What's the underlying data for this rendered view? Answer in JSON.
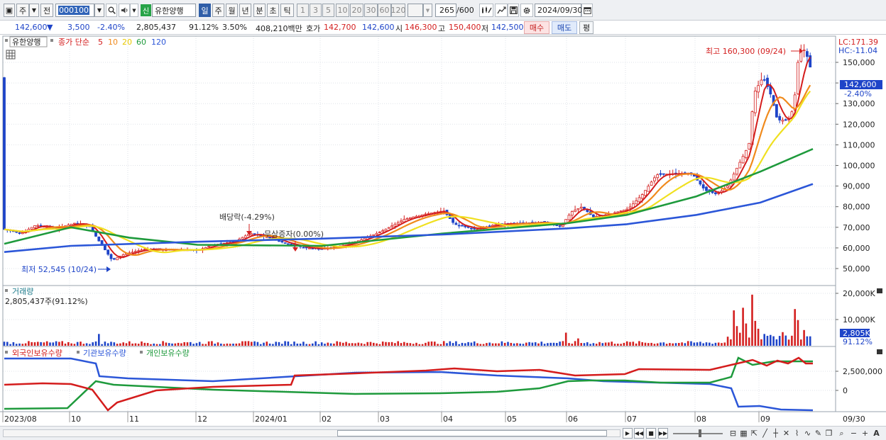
{
  "toolbar": {
    "period_label": "주",
    "prev_label": "전",
    "stock_code": "000100",
    "new_badge": "신",
    "stock_name": "유한양행",
    "timeframes": [
      "일",
      "주",
      "월",
      "년",
      "분",
      "초",
      "틱"
    ],
    "active_timeframe": "일",
    "intervals": [
      "1",
      "3",
      "5",
      "10",
      "20",
      "30",
      "60",
      "120"
    ],
    "bar_count": "265",
    "bar_total": "/600",
    "date": "2024/09/30"
  },
  "info": {
    "price": "142,600",
    "change_arrow": "▼",
    "change": "3,500",
    "change_pct": "-2.40%",
    "volume": "2,805,437",
    "volume_ratio": "91.12%",
    "turnover_pct": "3.50%",
    "amount": "408,210백만",
    "bid_label": "호가",
    "bid": "142,700",
    "ask": "142,600",
    "open_label": "시",
    "open": "146,300",
    "high_label": "고",
    "high": "150,400",
    "low_label": "저",
    "low": "142,500",
    "buy_label": "매수",
    "sell_label": "매도",
    "eval_label": "평"
  },
  "legend": {
    "stock": "유한양행",
    "ma_label": "종가 단순",
    "ma_periods": [
      "5",
      "10",
      "20",
      "60",
      "120"
    ],
    "ma_colors": [
      "#d41c1c",
      "#f08a1c",
      "#f0e020",
      "#1e9a3c",
      "#2b56d8"
    ]
  },
  "price_panel": {
    "lc": "LC:171.39",
    "hc": "HC:-11.04",
    "y_ticks": [
      "150,000",
      "140,000",
      "130,000",
      "120,000",
      "110,000",
      "100,000",
      "90,000",
      "80,000",
      "70,000",
      "60,000",
      "50,000"
    ],
    "current_tag": "142,600",
    "current_pct": "-2.40%",
    "high_annotation": "최고 160,300 (09/24)",
    "low_annotation": "최저 52,545 (10/24)",
    "dividend_annotation": "배당락(-4.29%)",
    "bonus_annotation": "무상증자(0.00%)"
  },
  "volume_panel": {
    "title": "거래량",
    "current": "2,805,437주(91.12%)",
    "y_ticks": [
      "20,000K",
      "10,000K"
    ],
    "tag_value": "2,805K",
    "tag_pct": "91.12%"
  },
  "holdings_panel": {
    "labels": [
      "외국인보유수량",
      "기관보유수량",
      "개인보유수량"
    ],
    "colors": [
      "#d41c1c",
      "#2b56d8",
      "#1e9a3c"
    ],
    "y_ticks": [
      "2,500,000",
      "0"
    ]
  },
  "x_axis": [
    "2023/08",
    "10",
    "11",
    "12",
    "2024/01",
    "02",
    "03",
    "04",
    "05",
    "06",
    "07",
    "08",
    "09",
    "09/30"
  ],
  "colors": {
    "up": "#d42020",
    "down": "#1e44c8",
    "accent": "#2f5ea8"
  },
  "chart_data": {
    "type": "line",
    "title": "",
    "series": [
      {
        "name": "종가",
        "x": [
          "2023/08",
          "2023/10",
          "2023/10/24",
          "2023/11",
          "2023/12",
          "2024/01",
          "2024/02",
          "2024/03",
          "2024/04",
          "2024/05",
          "2024/06",
          "2024/07",
          "2024/08",
          "2024/09",
          "2024/09/24",
          "2024/09/30"
        ],
        "values": [
          69000,
          71000,
          54000,
          59000,
          59500,
          66000,
          60000,
          70000,
          77000,
          72000,
          80000,
          94000,
          88000,
          145000,
          158000,
          142600
        ]
      },
      {
        "name": "120",
        "x": [
          "2023/08",
          "2023/10",
          "2023/12",
          "2024/02",
          "2024/04",
          "2024/06",
          "2024/07",
          "2024/08",
          "2024/09",
          "2024/09/30"
        ],
        "values": [
          58000,
          61000,
          63000,
          64500,
          66500,
          69500,
          71500,
          76000,
          82000,
          91000
        ]
      },
      {
        "name": "60",
        "x": [
          "2023/08",
          "2023/10",
          "2023/11",
          "2023/12",
          "2024/02",
          "2024/04",
          "2024/06",
          "2024/07",
          "2024/08",
          "2024/09",
          "2024/09/30"
        ],
        "values": [
          62000,
          70000,
          65000,
          61500,
          61000,
          67000,
          72000,
          76000,
          85000,
          97000,
          108000
        ]
      }
    ],
    "ylim": [
      45000,
      168000
    ]
  }
}
